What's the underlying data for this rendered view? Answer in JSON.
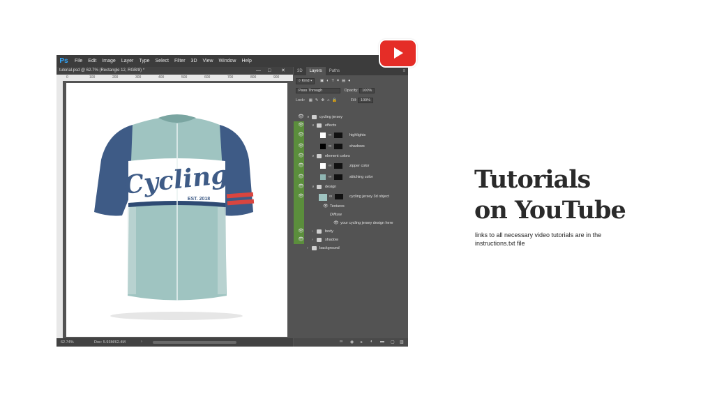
{
  "menubar": {
    "logo": "Ps",
    "items": [
      "File",
      "Edit",
      "Image",
      "Layer",
      "Type",
      "Select",
      "Filter",
      "3D",
      "View",
      "Window",
      "Help"
    ]
  },
  "document": {
    "tab_title": "tutorial.psd @ 62.7% (Rectangle 12, RGB/8) *",
    "controls": [
      "—",
      "□",
      "✕"
    ],
    "ruler_ticks": [
      "0",
      "100",
      "200",
      "300",
      "400",
      "500",
      "600",
      "700",
      "800",
      "900"
    ]
  },
  "canvas": {
    "jersey_word": "Cycling",
    "jersey_sub": "EST. 2018",
    "colors": {
      "body": "#9fc4c1",
      "sleeve": "#3e5b86",
      "stripe_red": "#d9453f",
      "chest_band": "#ffffff"
    }
  },
  "status": {
    "zoom": "62.74%",
    "doc": "Doc: 5.93M/62.4M"
  },
  "panel": {
    "tabs": [
      "3D",
      "Layers",
      "Paths"
    ],
    "kind_label": "Kind",
    "blend_mode": "Pass Through",
    "opacity_label": "Opacity:",
    "opacity_value": "100%",
    "lock_label": "Lock:",
    "fill_label": "Fill:",
    "fill_value": "100%"
  },
  "layers": [
    {
      "name": "cycling jersey",
      "type": "group",
      "indent": 0,
      "green": false
    },
    {
      "name": "effects",
      "type": "group",
      "indent": 1,
      "green": true
    },
    {
      "name": "highlights",
      "type": "layer",
      "indent": 2,
      "green": true,
      "thumb": "#ffffff"
    },
    {
      "name": "shadows",
      "type": "layer",
      "indent": 2,
      "green": true,
      "thumb": "#000000"
    },
    {
      "name": "element colors",
      "type": "group",
      "indent": 1,
      "green": true
    },
    {
      "name": "zipper color",
      "type": "layer",
      "indent": 2,
      "green": true,
      "thumb": "#ffffff"
    },
    {
      "name": "stitching color",
      "type": "layer",
      "indent": 2,
      "green": true,
      "thumb": "#8fb5b2"
    },
    {
      "name": "design",
      "type": "group",
      "indent": 1,
      "green": true
    },
    {
      "name": "cycling jersey 3d object",
      "type": "smart",
      "indent": 2,
      "green": true
    },
    {
      "name": "Textures",
      "type": "sub",
      "indent": 3,
      "green": true
    },
    {
      "name": "Diffuse",
      "type": "italic",
      "indent": 4,
      "green": true
    },
    {
      "name": "your cycling  jersey design here",
      "type": "sub",
      "indent": 4,
      "green": true
    },
    {
      "name": "body",
      "type": "group",
      "indent": 1,
      "green": true
    },
    {
      "name": "shadow",
      "type": "group",
      "indent": 1,
      "green": true
    },
    {
      "name": "background",
      "type": "group",
      "indent": 0,
      "green": false
    }
  ],
  "promo": {
    "title_line1": "Tutorials",
    "title_line2": "on YouTube",
    "subtitle": "links to all necessary video tutorials are in the instructions.txt file"
  }
}
